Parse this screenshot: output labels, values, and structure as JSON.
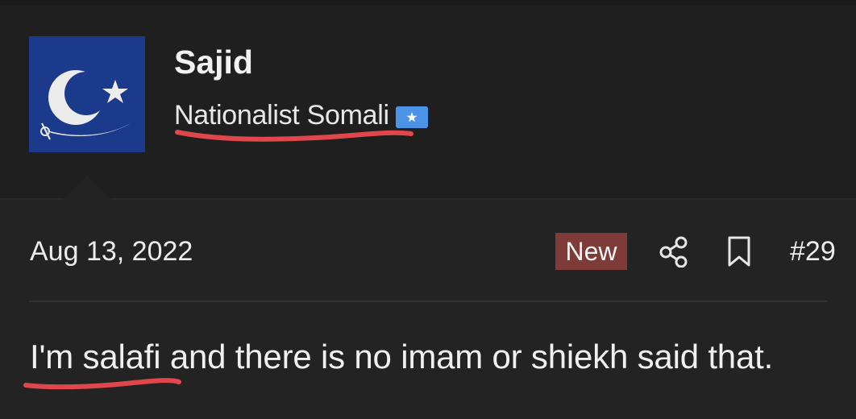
{
  "user": {
    "name": "Sajid",
    "title": "Nationalist Somali",
    "flag_icon": "somalia-flag-icon",
    "avatar_icon": "crescent-star-sword-avatar"
  },
  "post": {
    "date": "Aug 13, 2022",
    "badge": "New",
    "number": "#29",
    "message": "I'm salafi and there is no imam or shiekh said that."
  },
  "icons": {
    "share": "share-icon",
    "bookmark": "bookmark-icon"
  },
  "colors": {
    "background": "#232323",
    "user_block_background": "#1f1f1f",
    "avatar_background": "#1c3a8c",
    "badge_background": "#7e3b37",
    "annotation_red": "#e0474c",
    "text": "#ececec"
  }
}
